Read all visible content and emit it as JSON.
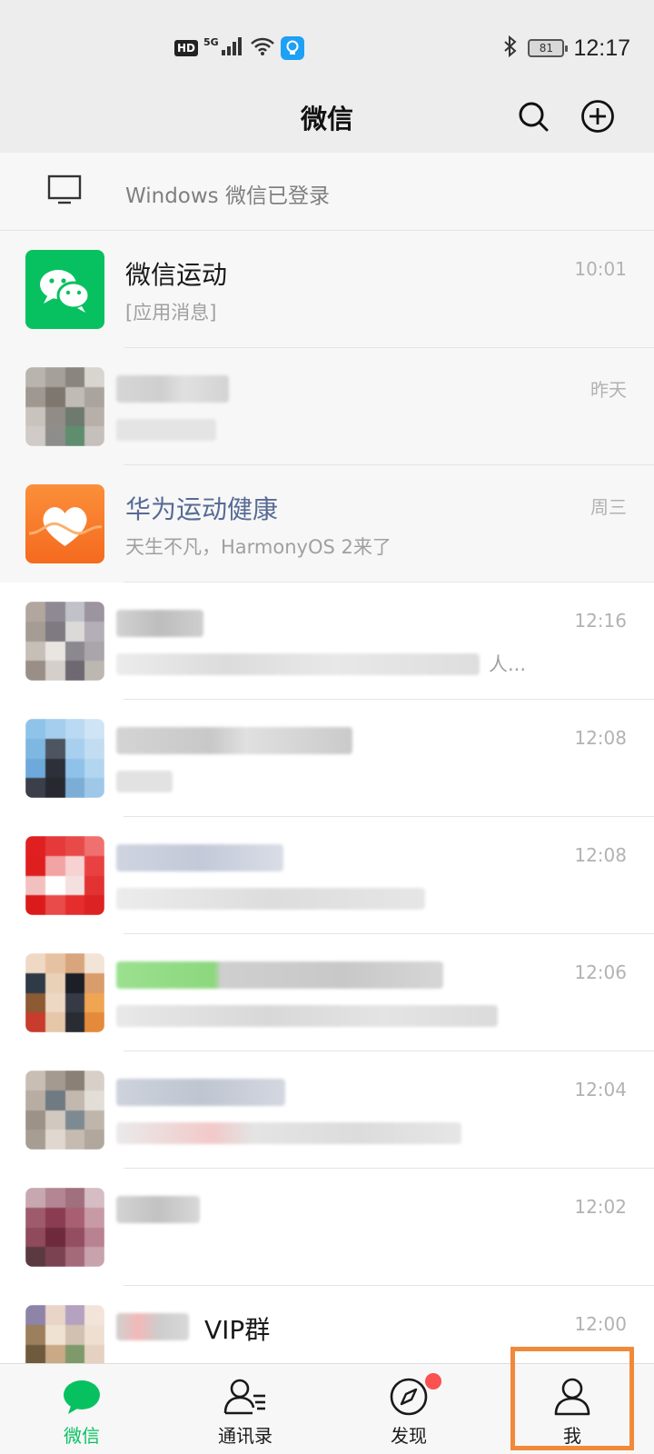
{
  "status_bar": {
    "hd": "HD",
    "network": "5G",
    "battery": "81",
    "time": "12:17"
  },
  "header": {
    "title": "微信",
    "search_icon": "search-icon",
    "add_icon": "plus-circle-icon"
  },
  "login_banner": {
    "icon": "monitor-icon",
    "text": "Windows 微信已登录"
  },
  "chats": [
    {
      "name": "微信运动",
      "message": "[应用消息]",
      "time": "10:01",
      "avatar": "wechat-sport-icon"
    },
    {
      "name": "",
      "message": "",
      "time": "昨天",
      "avatar": "blurred-avatar"
    },
    {
      "name": "华为运动健康",
      "message": "天生不凡，HarmonyOS 2来了",
      "time": "周三",
      "avatar": "huawei-health-icon"
    },
    {
      "name": "",
      "message": "人...",
      "time": "12:16",
      "avatar": "blurred-avatar"
    },
    {
      "name": "",
      "message": "",
      "time": "12:08",
      "avatar": "blurred-avatar"
    },
    {
      "name": "",
      "message": "",
      "time": "12:08",
      "avatar": "blurred-avatar"
    },
    {
      "name": "",
      "message": "",
      "time": "12:06",
      "avatar": "blurred-avatar"
    },
    {
      "name": "",
      "message": "",
      "time": "12:04",
      "avatar": "blurred-avatar"
    },
    {
      "name": "",
      "message": "",
      "time": "12:02",
      "avatar": "blurred-avatar"
    },
    {
      "name": "VIP群",
      "message": "",
      "time": "12:00",
      "avatar": "blurred-avatar"
    }
  ],
  "tabs": [
    {
      "label": "微信",
      "icon": "chat-bubble-icon",
      "active": true
    },
    {
      "label": "通讯录",
      "icon": "contacts-icon",
      "active": false
    },
    {
      "label": "发现",
      "icon": "compass-icon",
      "active": false,
      "badge": "red-dot"
    },
    {
      "label": "我",
      "icon": "person-icon",
      "active": false
    }
  ],
  "colors": {
    "accent": "#07c160",
    "link": "#576b95",
    "badge": "#fa5151",
    "highlight": "#f08a3a"
  }
}
